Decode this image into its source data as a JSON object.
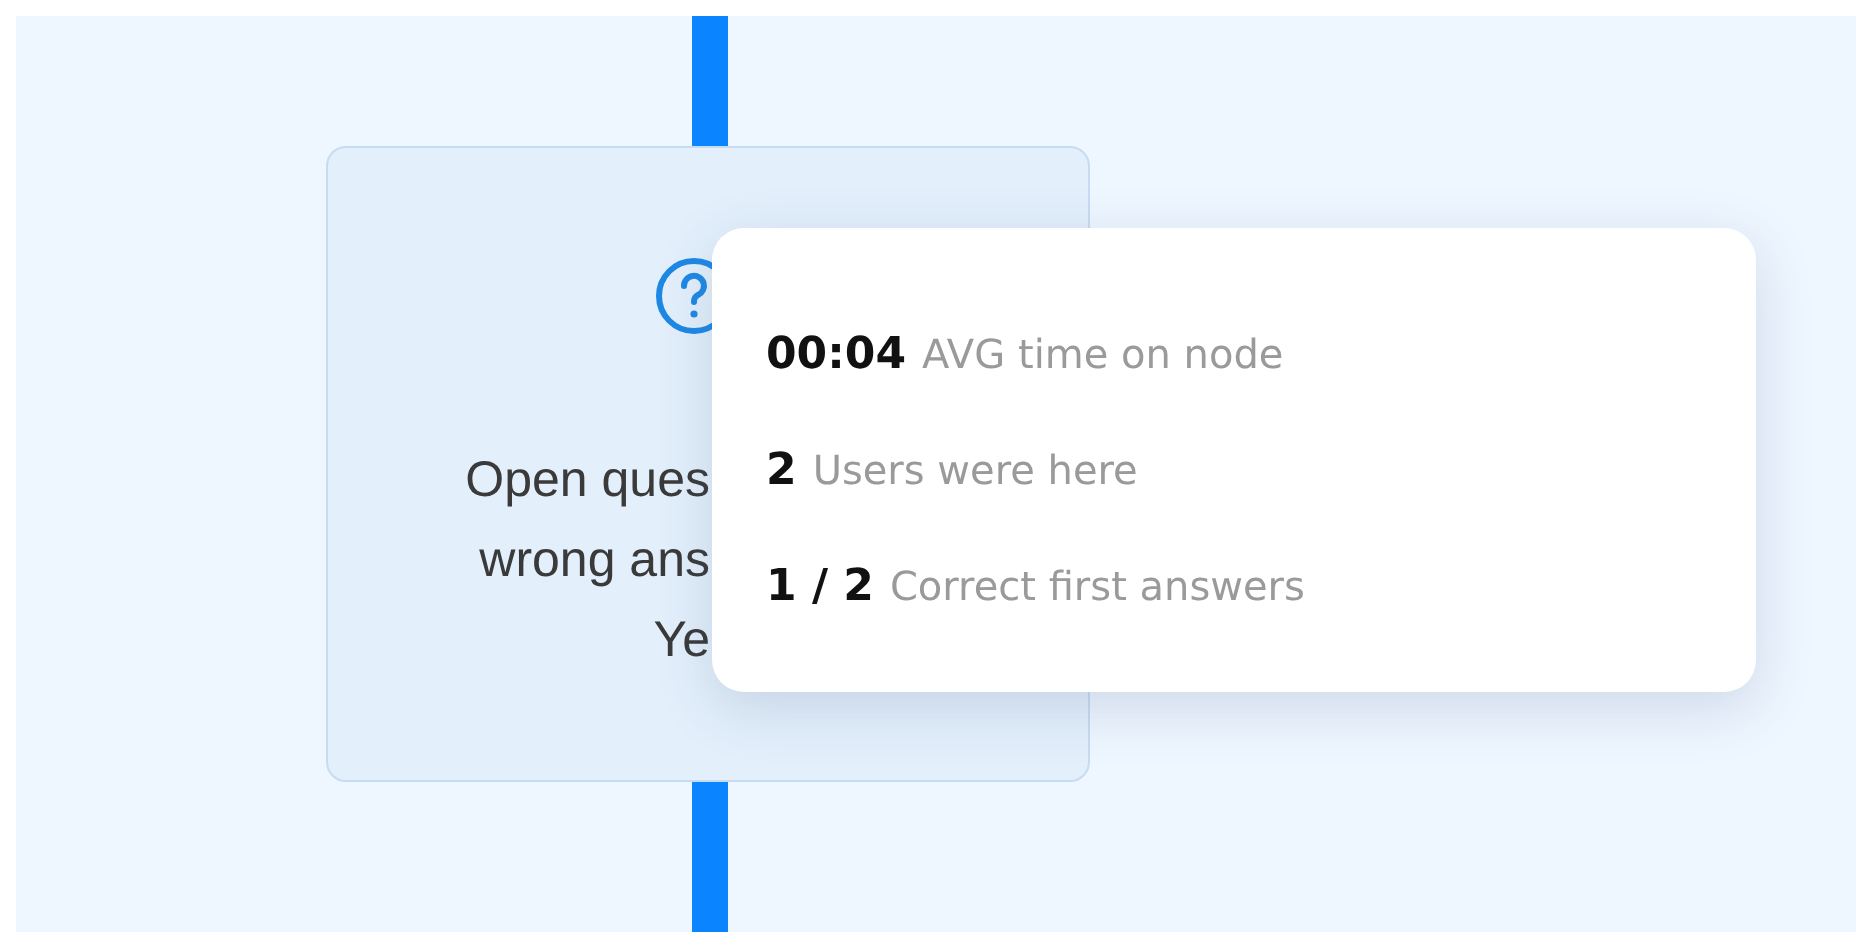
{
  "node": {
    "text_lines": [
      "Open ques",
      "wrong ans",
      "Ye"
    ]
  },
  "tooltip": {
    "stats": [
      {
        "value": "00:04",
        "label": "AVG time on node"
      },
      {
        "value": "2",
        "label": "Users were here"
      },
      {
        "value": "1 / 2",
        "label": "Correct first answers"
      }
    ]
  }
}
